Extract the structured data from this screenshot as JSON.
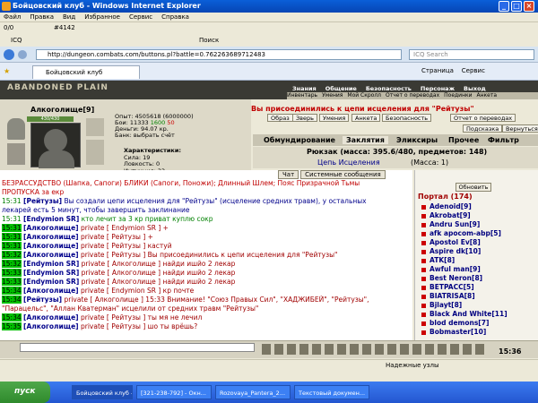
{
  "window": {
    "title": "Бойцовский клуб - Windows Internet Explorer"
  },
  "menu": [
    "Файл",
    "Правка",
    "Вид",
    "Избранное",
    "Сервис",
    "Справка"
  ],
  "toolbar": {
    "counter": "0/0",
    "ticket": "#4142"
  },
  "bookmarks": {
    "icq": "ICQ",
    "search": "Поиск"
  },
  "address": {
    "url": "http://dungeon.combats.com/buttons.pl?battle=0.762263689712483",
    "search_placeholder": "ICQ Search"
  },
  "tab": {
    "label": "Бойцовский клуб",
    "tools": [
      "Страница",
      "Сервис"
    ]
  },
  "game": {
    "logo": "ABANDONED PLAIN",
    "nav_main": [
      "Знания",
      "Общение",
      "Безопасность",
      "Персонаж",
      "Выход"
    ],
    "nav_sub": [
      "Инвентарь",
      "Умения",
      "Мой Скролл",
      "Отчет о переводах",
      "Поединки",
      "Анкета"
    ]
  },
  "character": {
    "name": "Алкоголище",
    "level": "[9]",
    "hp": "430/430",
    "exp": "Опыт: 4505618",
    "exp_next": "(6000000)",
    "battles": "Бои: 11333",
    "wins": "1600",
    "losses": "50",
    "money": "Деньги: 94.07 кр.",
    "bank": "Банк: выбрать счёт",
    "chars_title": "Характеристики:",
    "strength": "Сила: 19",
    "agility": "Ловкость: 0",
    "intuition": "Интуиция: 33"
  },
  "alert": "Вы присоединились к цепи исцеления для \"Рейтузы\"",
  "buttons": [
    "Образ",
    "Зверь",
    "Умения",
    "Анкета",
    "Безопасность",
    "Отчет о переводах",
    "Подсказка",
    "Вернуться"
  ],
  "subtabs": [
    "Обмундирование",
    "Заклятия",
    "Эликсиры",
    "Прочее",
    "Фильтр"
  ],
  "backpack": "Рюкзак (масса: 395.6/480, предметов: 148)",
  "healing_chain": "Цепь Исцеления",
  "healing_mass": "(Масса: 1)",
  "chat_tabs": [
    "Чат",
    "Системные сообщения"
  ],
  "chat": [
    {
      "time": "",
      "nick": "",
      "text": "БЕЗРАССУДСТВО (Шапка, Сапоги)   БЛИКИ (Сапоги, Поножи); Длинный Шлем; Пояс Призрачной Тьмы",
      "kind": "r"
    },
    {
      "time": "",
      "nick": "",
      "text": "ПРОПУСКА за екр",
      "kind": "r"
    },
    {
      "time": "15:31",
      "nick": "[Рейтузы]",
      "text": "Вы создали цепи исцеления для \"Рейтузы\" (исцеление средних травм), у остальных",
      "kind": "b"
    },
    {
      "time": "",
      "nick": "",
      "text": "лекарей есть 5 минут, чтобы завершить заклинание",
      "kind": "b"
    },
    {
      "time": "15:31",
      "nick": "[Endymion SR]",
      "text": "кто лечит за 3 кр приват куплю сокр",
      "kind": "g"
    },
    {
      "time": "15:31",
      "nick": "[Алкоголище]",
      "text": "private [ Endymion SR ] +",
      "kind": "pv"
    },
    {
      "time": "15:31",
      "nick": "[Алкоголище]",
      "text": "private [ Рейтузы ] +",
      "kind": "pv"
    },
    {
      "time": "15:31",
      "nick": "[Алкоголище]",
      "text": "private [ Рейтузы ] кастуй",
      "kind": "pv"
    },
    {
      "time": "15:32",
      "nick": "[Алкоголище]",
      "text": "private [ Рейтузы ] Вы присоединились к цепи исцеления для \"Рейтузы\"",
      "kind": "pv"
    },
    {
      "time": "15:32",
      "nick": "[Endymion SR]",
      "text": "private [ Алкоголище ] найди ишйо 2 лекар",
      "kind": "pv"
    },
    {
      "time": "15:33",
      "nick": "[Endymion SR]",
      "text": "private [ Алкоголище ] найди ишйо 2 лекар",
      "kind": "pv"
    },
    {
      "time": "15:33",
      "nick": "[Endymion SR]",
      "text": "private [ Алкоголище ] найди ишйо 2 лекар",
      "kind": "pv"
    },
    {
      "time": "15:34",
      "nick": "[Алкоголище]",
      "text": "private [ Endymion SR ] кр почте",
      "kind": "pv"
    },
    {
      "time": "15:34",
      "nick": "[Рейтузы]",
      "text": "private [ Алкоголище ] 15:33 Внимание! \"Союз Правых Сил\", \"ХАДЖИБЕЙ\", \"Рейтузы\",",
      "kind": "pv"
    },
    {
      "time": "",
      "nick": "",
      "text": "\"Парацельс\", \"Аллан Кватерман\" исцелили от средних травм \"Рейтузы\"",
      "kind": "pv"
    },
    {
      "time": "15:34",
      "nick": "[Алкоголище]",
      "text": "private [ Рейтузы ] ты мя не лечил",
      "kind": "pv"
    },
    {
      "time": "15:35",
      "nick": "[Алкоголище]",
      "text": "private [ Рейтузы ] шо ты врёшь?",
      "kind": "pv"
    }
  ],
  "sidebar": {
    "refresh": "Обновить",
    "title": "Портал (174)",
    "players": [
      "Adenoid[9]",
      "Akrobat[9]",
      "Andru Sun[9]",
      "afk apocom-abp[5]",
      "Apostol Ev[8]",
      "Aspire dk[10]",
      "ATK[8]",
      "Awful man[9]",
      "Best Neron[8]",
      "BETPACC[5]",
      "BIATRISA[8]",
      "Bjlayt[8]",
      "Black And White[11]",
      "blod demons[7]",
      "Bobmaster[10]"
    ]
  },
  "clock": "15:36",
  "ie_status": "Надежные узлы",
  "taskbar": {
    "start": "пуск",
    "items": [
      "Бойцовский клуб - ...",
      "[321-238-792] - Окн...",
      "Rozovaya_Pantera_2...",
      "Текстовый докумен..."
    ]
  }
}
